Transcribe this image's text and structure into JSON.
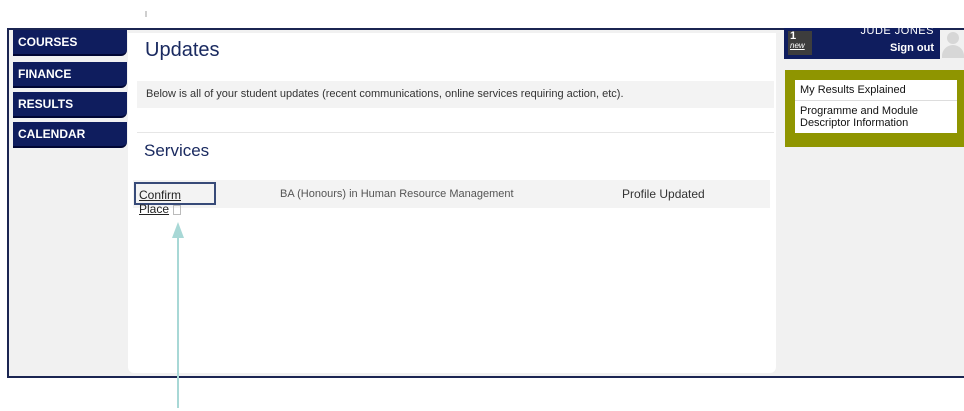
{
  "nav": {
    "items": [
      {
        "label": "COURSES"
      },
      {
        "label": "FINANCE"
      },
      {
        "label": "RESULTS"
      },
      {
        "label": "CALENDAR"
      }
    ]
  },
  "main": {
    "title": "Updates",
    "info_text": "Below is all of your student updates (recent communications, online services requiring action, etc).",
    "services_title": "Services",
    "service_row": {
      "action_label": "Confirm Place",
      "course": "BA (Honours) in Human Resource Management",
      "status": "Profile Updated"
    }
  },
  "user": {
    "badge_count": "1",
    "badge_word": "new",
    "name": "JUDE JONES",
    "sign_out": "Sign out"
  },
  "side_links": {
    "items": [
      {
        "label": "My Results Explained"
      },
      {
        "label": "Programme and Module Descriptor Information"
      }
    ]
  },
  "colors": {
    "nav_bg": "#0f1d5e",
    "side_box": "#8f9500",
    "arrow": "#a8d8d6"
  },
  "icons": {
    "external": "external-link-icon",
    "arrow": "arrow-up-icon",
    "avatar": "user-avatar-icon"
  }
}
